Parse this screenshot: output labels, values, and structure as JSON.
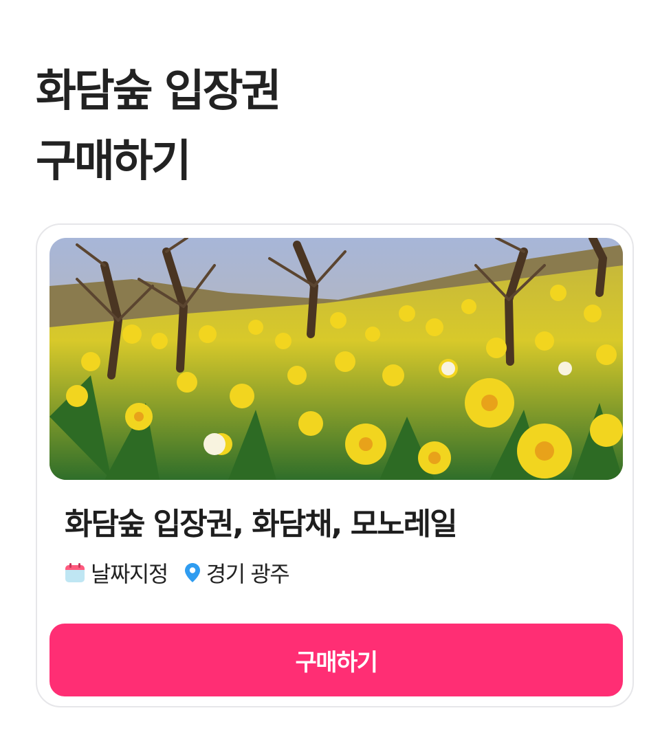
{
  "page": {
    "title_line1": "화담숲 입장권",
    "title_line2": "구매하기"
  },
  "product": {
    "image_alt": "화담숲 수선화 언덕 사진",
    "name": "화담숲 입장권, 화담채, 모노레일",
    "date_type": "날짜지정",
    "location": "경기 광주",
    "date_icon": "calendar-icon",
    "location_icon": "map-pin-icon"
  },
  "actions": {
    "buy_label": "구매하기"
  },
  "colors": {
    "accent": "#ff2e74",
    "pin": "#2f9cf0",
    "calendar_top": "#ff5a7e",
    "calendar_body": "#bfe6f3",
    "card_border": "#e6e6e9"
  }
}
